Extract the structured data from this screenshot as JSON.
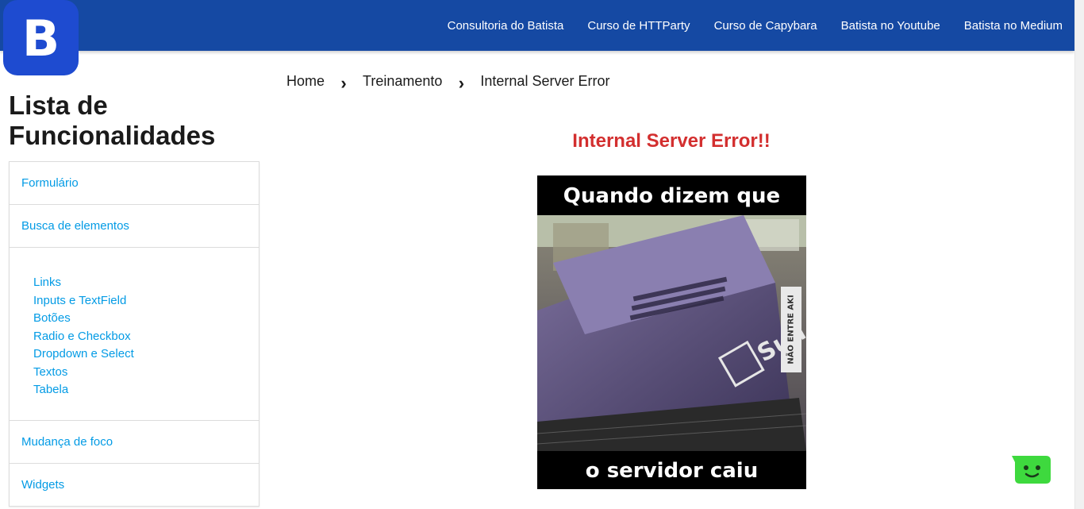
{
  "logo": {
    "letter": "B"
  },
  "nav": [
    {
      "label": "Consultoria do Batista"
    },
    {
      "label": "Curso de HTTParty"
    },
    {
      "label": "Curso de Capybara"
    },
    {
      "label": "Batista no Youtube"
    },
    {
      "label": "Batista no Medium"
    }
  ],
  "sidebar": {
    "title": "Lista de Funcionalidades",
    "items": [
      {
        "label": "Formulário"
      },
      {
        "label": "Busca de elementos"
      }
    ],
    "subitems": [
      {
        "label": "Links"
      },
      {
        "label": "Inputs e TextField"
      },
      {
        "label": "Botões"
      },
      {
        "label": "Radio e Checkbox"
      },
      {
        "label": "Dropdown e Select"
      },
      {
        "label": "Textos"
      },
      {
        "label": "Tabela"
      }
    ],
    "bottom_items": [
      {
        "label": "Mudança de foco"
      },
      {
        "label": "Widgets"
      }
    ]
  },
  "breadcrumb": {
    "items": [
      "Home",
      "Treinamento",
      "Internal Server Error"
    ],
    "separator": "›"
  },
  "main": {
    "error_title": "Internal Server Error!!",
    "meme": {
      "top_text": "Quando dizem que",
      "bottom_text": "o servidor caiu",
      "watermark": "NÃO ENTRE AKI"
    }
  },
  "colors": {
    "topbar": "#1549a3",
    "logo": "#1e4bd0",
    "link": "#039be5",
    "error": "#d32f2f",
    "chat": "#3ed93e"
  },
  "icons": {
    "breadcrumb_separator": "chevron-right-icon",
    "chat": "chat-bot-icon"
  }
}
